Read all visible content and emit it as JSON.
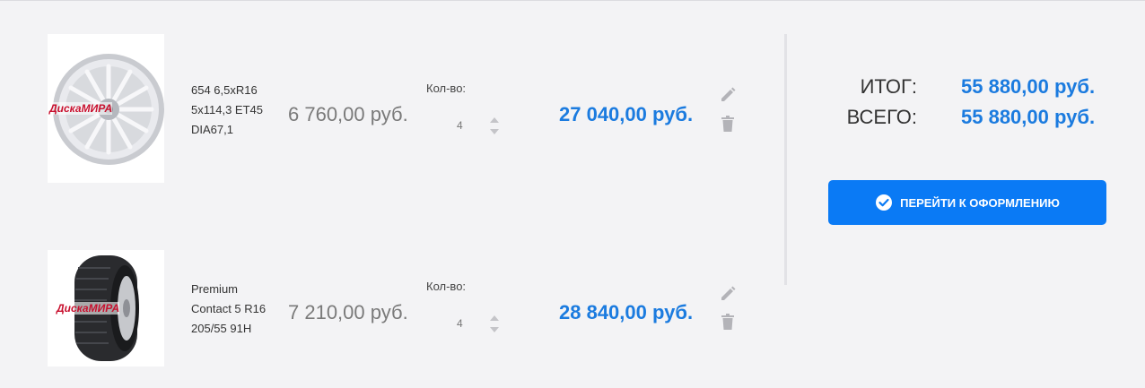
{
  "cart": {
    "items": [
      {
        "image": "wheel-rim-image",
        "brand_overlay": "ДискаМИРА",
        "name_lines": [
          "654 6,5xR16",
          "5x114,3 ET45",
          "DIA67,1"
        ],
        "unit_price": "6 760,00 руб.",
        "qty_label": "Кол-во:",
        "qty": "4",
        "total": "27 040,00 руб."
      },
      {
        "image": "tire-image",
        "brand_overlay": "ДискаМИРА",
        "name_lines": [
          "Premium",
          "Contact 5 R16",
          "205/55 91H"
        ],
        "unit_price": "7 210,00 руб.",
        "qty_label": "Кол-во:",
        "qty": "4",
        "total": "28 840,00 руб."
      }
    ]
  },
  "summary": {
    "subtotal_label": "ИТОГ:",
    "subtotal_value": "55 880,00 руб.",
    "total_label": "ВСЕГО:",
    "total_value": "55 880,00 руб.",
    "checkout_label": "ПЕРЕЙТИ К ОФОРМЛЕНИЮ"
  },
  "colors": {
    "accent": "#1b7bdf",
    "button": "#0a7af5",
    "background": "#f3f3f5"
  }
}
